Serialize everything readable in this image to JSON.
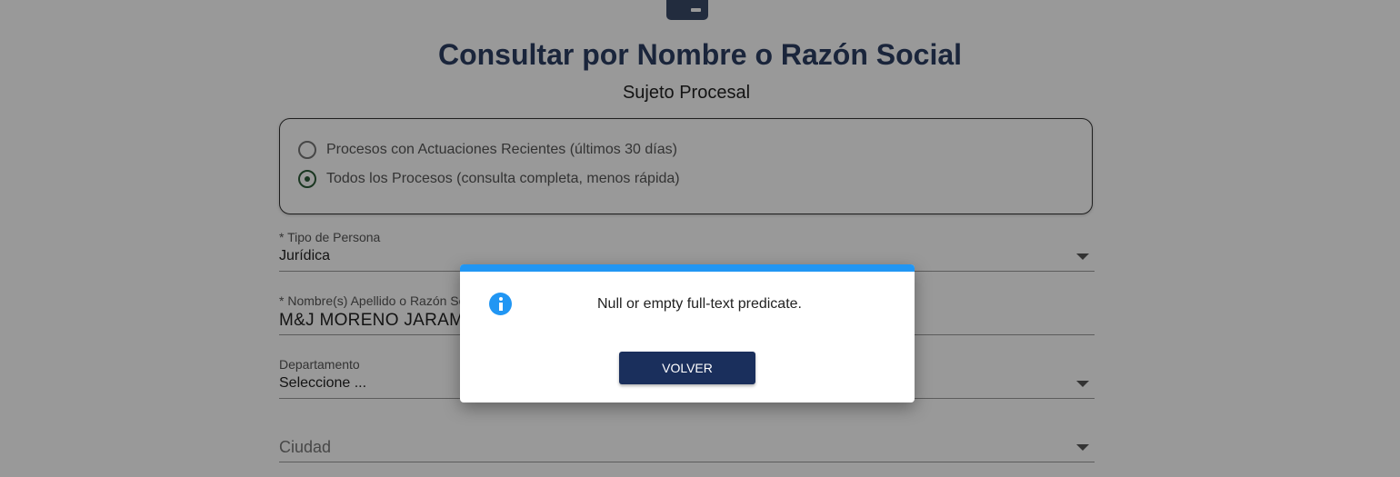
{
  "header": {
    "title": "Consultar por Nombre o Razón Social",
    "subtitle": "Sujeto Procesal"
  },
  "search_scope": {
    "options": [
      {
        "label": "Procesos con Actuaciones Recientes (últimos 30 días)",
        "selected": false
      },
      {
        "label": "Todos los Procesos (consulta completa, menos rápida)",
        "selected": true
      }
    ]
  },
  "form": {
    "tipo_persona": {
      "label": "* Tipo de Persona",
      "value": "Jurídica"
    },
    "nombre": {
      "label": "* Nombre(s) Apellido o Razón Social",
      "value": "M&J MORENO JARAMILLO"
    },
    "departamento": {
      "label": "Departamento",
      "value": "Seleccione ..."
    },
    "ciudad": {
      "placeholder": "Ciudad"
    }
  },
  "dialog": {
    "message": "Null or empty full-text predicate.",
    "button_label": "VOLVER",
    "accent_color": "#2196f3",
    "button_color": "#1a2f5c",
    "icon": "info-icon"
  }
}
